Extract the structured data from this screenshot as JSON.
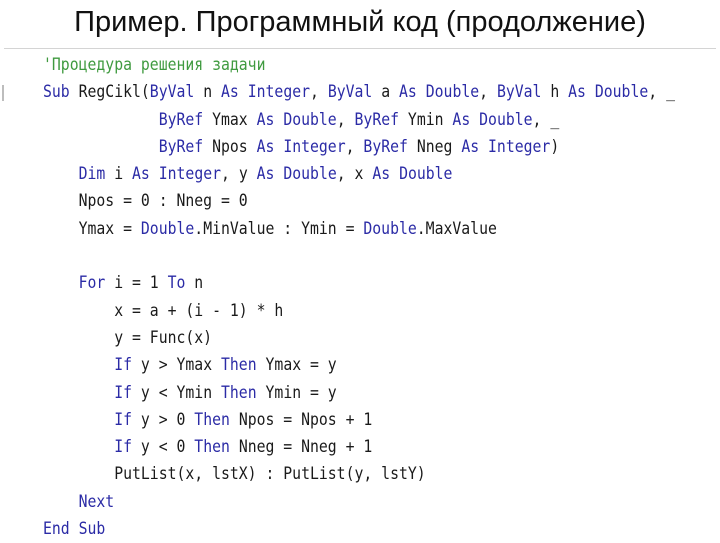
{
  "title": "Пример. Программный код (продолжение)",
  "colors": {
    "keyword": "#2b2ba6",
    "comment": "#3f9a3f",
    "text": "#1a1a1a"
  },
  "code": {
    "language": "Visual Basic",
    "lines": [
      [
        {
          "t": "cm",
          "s": "'Процедура решения задачи"
        }
      ],
      [
        {
          "t": "kw",
          "s": "Sub"
        },
        {
          "t": "tx",
          "s": " RegCikl("
        },
        {
          "t": "kw",
          "s": "ByVal"
        },
        {
          "t": "tx",
          "s": " n "
        },
        {
          "t": "kw",
          "s": "As"
        },
        {
          "t": "tx",
          "s": " "
        },
        {
          "t": "kw",
          "s": "Integer"
        },
        {
          "t": "tx",
          "s": ", "
        },
        {
          "t": "kw",
          "s": "ByVal"
        },
        {
          "t": "tx",
          "s": " a "
        },
        {
          "t": "kw",
          "s": "As"
        },
        {
          "t": "tx",
          "s": " "
        },
        {
          "t": "kw",
          "s": "Double"
        },
        {
          "t": "tx",
          "s": ", "
        },
        {
          "t": "kw",
          "s": "ByVal"
        },
        {
          "t": "tx",
          "s": " h "
        },
        {
          "t": "kw",
          "s": "As"
        },
        {
          "t": "tx",
          "s": " "
        },
        {
          "t": "kw",
          "s": "Double"
        },
        {
          "t": "tx",
          "s": ", _"
        }
      ],
      [
        {
          "t": "tx",
          "s": "             "
        },
        {
          "t": "kw",
          "s": "ByRef"
        },
        {
          "t": "tx",
          "s": " Ymax "
        },
        {
          "t": "kw",
          "s": "As"
        },
        {
          "t": "tx",
          "s": " "
        },
        {
          "t": "kw",
          "s": "Double"
        },
        {
          "t": "tx",
          "s": ", "
        },
        {
          "t": "kw",
          "s": "ByRef"
        },
        {
          "t": "tx",
          "s": " Ymin "
        },
        {
          "t": "kw",
          "s": "As"
        },
        {
          "t": "tx",
          "s": " "
        },
        {
          "t": "kw",
          "s": "Double"
        },
        {
          "t": "tx",
          "s": ", _"
        }
      ],
      [
        {
          "t": "tx",
          "s": "             "
        },
        {
          "t": "kw",
          "s": "ByRef"
        },
        {
          "t": "tx",
          "s": " Npos "
        },
        {
          "t": "kw",
          "s": "As"
        },
        {
          "t": "tx",
          "s": " "
        },
        {
          "t": "kw",
          "s": "Integer"
        },
        {
          "t": "tx",
          "s": ", "
        },
        {
          "t": "kw",
          "s": "ByRef"
        },
        {
          "t": "tx",
          "s": " Nneg "
        },
        {
          "t": "kw",
          "s": "As"
        },
        {
          "t": "tx",
          "s": " "
        },
        {
          "t": "kw",
          "s": "Integer"
        },
        {
          "t": "tx",
          "s": ")"
        }
      ],
      [
        {
          "t": "tx",
          "s": "    "
        },
        {
          "t": "kw",
          "s": "Dim"
        },
        {
          "t": "tx",
          "s": " i "
        },
        {
          "t": "kw",
          "s": "As"
        },
        {
          "t": "tx",
          "s": " "
        },
        {
          "t": "kw",
          "s": "Integer"
        },
        {
          "t": "tx",
          "s": ", y "
        },
        {
          "t": "kw",
          "s": "As"
        },
        {
          "t": "tx",
          "s": " "
        },
        {
          "t": "kw",
          "s": "Double"
        },
        {
          "t": "tx",
          "s": ", x "
        },
        {
          "t": "kw",
          "s": "As"
        },
        {
          "t": "tx",
          "s": " "
        },
        {
          "t": "kw",
          "s": "Double"
        }
      ],
      [
        {
          "t": "tx",
          "s": "    Npos = 0 : Nneg = 0"
        }
      ],
      [
        {
          "t": "tx",
          "s": "    Ymax = "
        },
        {
          "t": "kw",
          "s": "Double"
        },
        {
          "t": "tx",
          "s": ".MinValue : Ymin = "
        },
        {
          "t": "kw",
          "s": "Double"
        },
        {
          "t": "tx",
          "s": ".MaxValue"
        }
      ],
      [
        {
          "t": "tx",
          "s": ""
        }
      ],
      [
        {
          "t": "tx",
          "s": "    "
        },
        {
          "t": "kw",
          "s": "For"
        },
        {
          "t": "tx",
          "s": " i = 1 "
        },
        {
          "t": "kw",
          "s": "To"
        },
        {
          "t": "tx",
          "s": " n"
        }
      ],
      [
        {
          "t": "tx",
          "s": "        x = a + (i - 1) * h"
        }
      ],
      [
        {
          "t": "tx",
          "s": "        y = Func(x)"
        }
      ],
      [
        {
          "t": "tx",
          "s": "        "
        },
        {
          "t": "kw",
          "s": "If"
        },
        {
          "t": "tx",
          "s": " y > Ymax "
        },
        {
          "t": "kw",
          "s": "Then"
        },
        {
          "t": "tx",
          "s": " Ymax = y"
        }
      ],
      [
        {
          "t": "tx",
          "s": "        "
        },
        {
          "t": "kw",
          "s": "If"
        },
        {
          "t": "tx",
          "s": " y < Ymin "
        },
        {
          "t": "kw",
          "s": "Then"
        },
        {
          "t": "tx",
          "s": " Ymin = y"
        }
      ],
      [
        {
          "t": "tx",
          "s": "        "
        },
        {
          "t": "kw",
          "s": "If"
        },
        {
          "t": "tx",
          "s": " y > 0 "
        },
        {
          "t": "kw",
          "s": "Then"
        },
        {
          "t": "tx",
          "s": " Npos = Npos + 1"
        }
      ],
      [
        {
          "t": "tx",
          "s": "        "
        },
        {
          "t": "kw",
          "s": "If"
        },
        {
          "t": "tx",
          "s": " y < 0 "
        },
        {
          "t": "kw",
          "s": "Then"
        },
        {
          "t": "tx",
          "s": " Nneg = Nneg + 1"
        }
      ],
      [
        {
          "t": "tx",
          "s": "        PutList(x, lstX) : PutList(y, lstY)"
        }
      ],
      [
        {
          "t": "tx",
          "s": "    "
        },
        {
          "t": "kw",
          "s": "Next"
        }
      ],
      [
        {
          "t": "kw",
          "s": "End"
        },
        {
          "t": "tx",
          "s": " "
        },
        {
          "t": "kw",
          "s": "Sub"
        }
      ]
    ]
  }
}
